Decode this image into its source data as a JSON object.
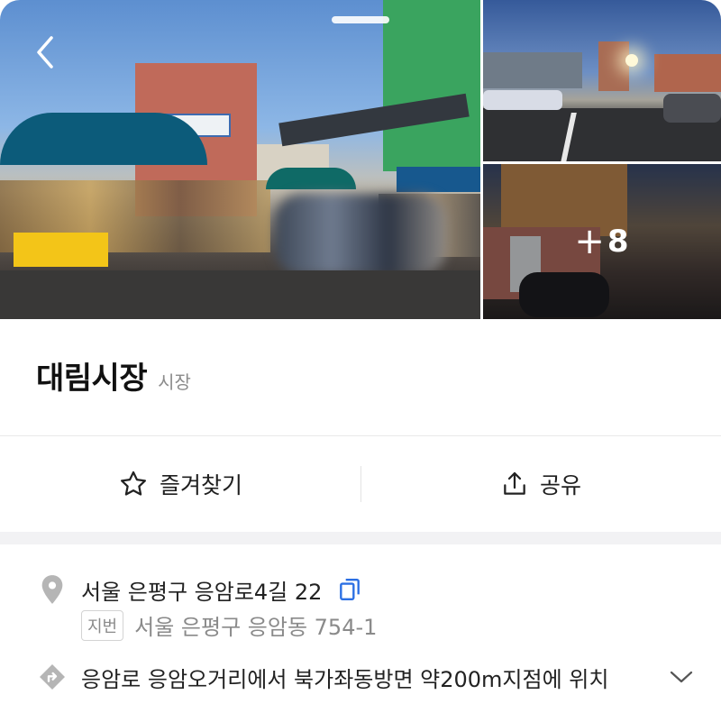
{
  "gallery": {
    "more_count": "8",
    "more_plus": "+"
  },
  "place": {
    "name": "대림시장",
    "category": "시장"
  },
  "actions": {
    "favorite_label": "즐겨찾기",
    "share_label": "공유"
  },
  "info": {
    "road_address": "서울 은평구 응암로4길 22",
    "jibun_badge": "지번",
    "jibun_address": "서울 은평구 응암동 754-1",
    "directions": "응암로 응암오거리에서 북가좌동방면 약200m지점에 위치"
  },
  "colors": {
    "accent_blue": "#2b6fe3",
    "icon_gray": "#b5b5b5",
    "text_primary": "#111111",
    "text_secondary": "#8a8a8a"
  },
  "icons": {
    "back": "chevron-left-icon",
    "favorite": "star-outline-icon",
    "share": "share-icon",
    "location": "location-pin-icon",
    "copy": "copy-icon",
    "directions": "directions-icon",
    "expand": "chevron-down-icon"
  }
}
